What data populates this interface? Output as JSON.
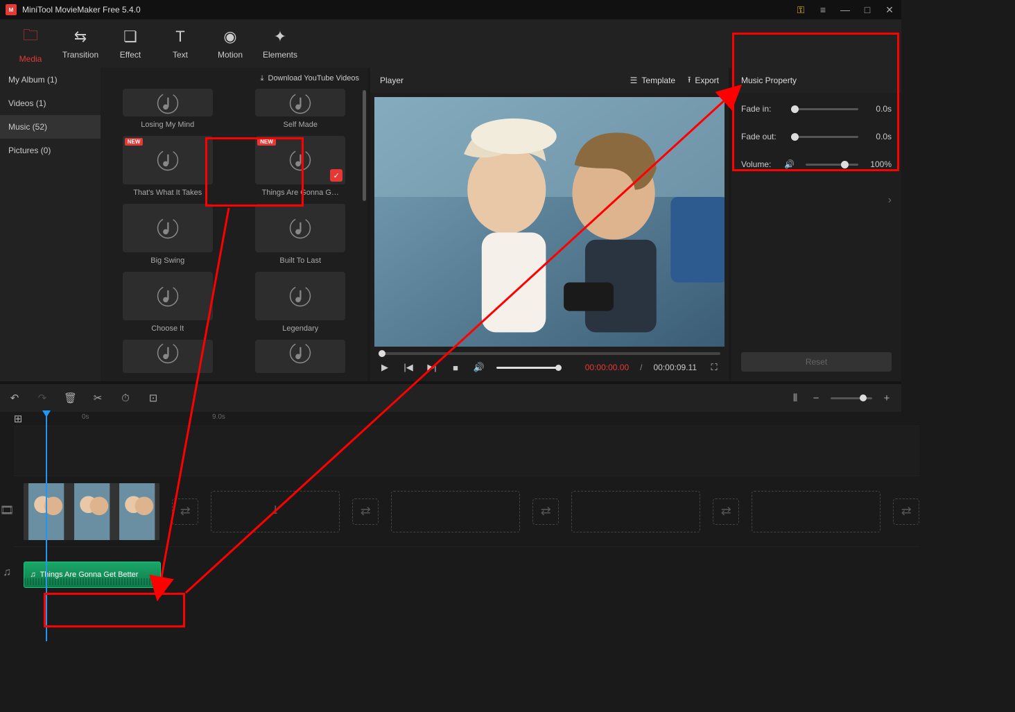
{
  "title_bar": {
    "app_title": "MiniTool MovieMaker Free 5.4.0"
  },
  "top_tabs": [
    {
      "key": "media",
      "label": "Media",
      "active": true
    },
    {
      "key": "transition",
      "label": "Transition",
      "active": false
    },
    {
      "key": "effect",
      "label": "Effect",
      "active": false
    },
    {
      "key": "text",
      "label": "Text",
      "active": false
    },
    {
      "key": "motion",
      "label": "Motion",
      "active": false
    },
    {
      "key": "elements",
      "label": "Elements",
      "active": false
    }
  ],
  "sidebar_items": [
    {
      "label": "My Album (1)",
      "active": false
    },
    {
      "label": "Videos (1)",
      "active": false
    },
    {
      "label": "Music (52)",
      "active": true
    },
    {
      "label": "Pictures (0)",
      "active": false
    }
  ],
  "download_link": "Download YouTube Videos",
  "media_cards": [
    {
      "label": "Losing My Mind",
      "new": false,
      "checked": false,
      "partial": "top"
    },
    {
      "label": "Self Made",
      "new": false,
      "checked": false,
      "partial": "top"
    },
    {
      "label": "That's What It Takes",
      "new": true,
      "checked": false,
      "partial": ""
    },
    {
      "label": "Things Are Gonna G…",
      "new": true,
      "checked": true,
      "partial": ""
    },
    {
      "label": "Big Swing",
      "new": false,
      "checked": false,
      "partial": ""
    },
    {
      "label": "Built To Last",
      "new": false,
      "checked": false,
      "partial": ""
    },
    {
      "label": "Choose It",
      "new": false,
      "checked": false,
      "partial": ""
    },
    {
      "label": "Legendary",
      "new": false,
      "checked": false,
      "partial": ""
    },
    {
      "label": "",
      "new": false,
      "checked": false,
      "partial": "bottom"
    },
    {
      "label": "",
      "new": false,
      "checked": false,
      "partial": "bottom"
    }
  ],
  "player": {
    "title": "Player",
    "template_label": "Template",
    "export_label": "Export",
    "time_current": "00:00:00.00",
    "time_separator": "/",
    "time_duration": "00:00:09.11"
  },
  "props": {
    "title": "Music Property",
    "fade_in_label": "Fade in:",
    "fade_in_value": "0.0s",
    "fade_out_label": "Fade out:",
    "fade_out_value": "0.0s",
    "volume_label": "Volume:",
    "volume_value": "100%",
    "reset_label": "Reset"
  },
  "timeline": {
    "ruler_0": "0s",
    "ruler_9": "9.0s",
    "audio_clip_label": "Things Are Gonna Get Better"
  }
}
